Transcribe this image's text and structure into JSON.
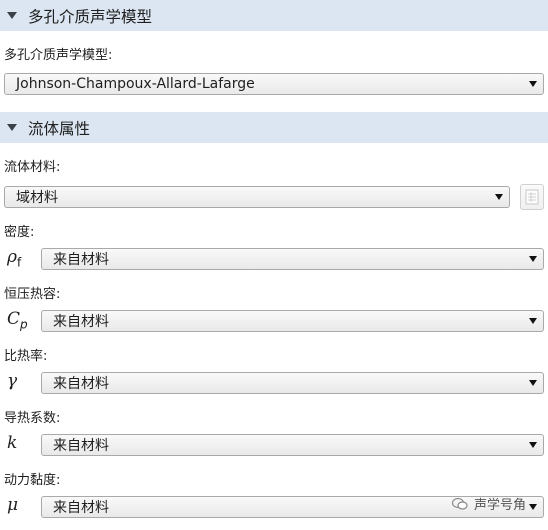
{
  "sections": {
    "porous_model": {
      "title": "多孔介质声学模型"
    },
    "fluid_props": {
      "title": "流体属性"
    }
  },
  "porous_model": {
    "label": "多孔介质声学模型:",
    "selected": "Johnson-Champoux-Allard-Lafarge"
  },
  "fluid": {
    "material_label": "流体材料:",
    "material_selected": "域材料",
    "properties": [
      {
        "label": "密度:",
        "symbol": "ρ",
        "subscript": "f",
        "value": "来自材料"
      },
      {
        "label": "恒压热容:",
        "symbol": "C",
        "subscript": "p",
        "value": "来自材料"
      },
      {
        "label": "比热率:",
        "symbol": "γ",
        "subscript": "",
        "value": "来自材料"
      },
      {
        "label": "导热系数:",
        "symbol": "k",
        "subscript": "",
        "value": "来自材料"
      },
      {
        "label": "动力黏度:",
        "symbol": "μ",
        "subscript": "",
        "value": "来自材料"
      }
    ]
  },
  "watermark": {
    "text": "声学号角"
  },
  "colors": {
    "header_bg": "#dbe6f2",
    "combo_border": "#a9a9a9"
  },
  "icons": {
    "section_toggle": "triangle-down-icon",
    "dropdown": "chevron-down-icon",
    "material_browser": "table-icon",
    "watermark": "wechat-icon"
  }
}
